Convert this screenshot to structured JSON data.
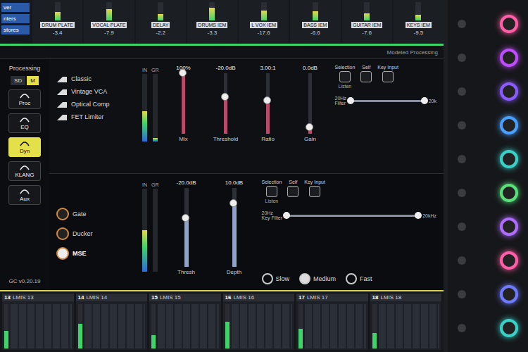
{
  "left_tabs": [
    "ver",
    "nters",
    "stores"
  ],
  "top_strips": [
    {
      "name": "DRUM PLATE",
      "reading": "-3.4",
      "level": 0.45
    },
    {
      "name": "VOCAL PLATE",
      "reading": "-7.9",
      "level": 0.6
    },
    {
      "name": "DELAY",
      "reading": "-2.2",
      "level": 0.35
    },
    {
      "name": "DRUMS IEM",
      "reading": "-3.3",
      "level": 0.7
    },
    {
      "name": "L VOX IEM",
      "reading": "-17.6",
      "level": 0.55
    },
    {
      "name": "BASS IEM",
      "reading": "-6.6",
      "level": 0.5
    },
    {
      "name": "GUITAR IEM",
      "reading": "-7.6",
      "level": 0.4
    },
    {
      "name": "KEYS IEM",
      "reading": "-9.5",
      "level": 0.3
    }
  ],
  "section_title": "Modeled Processing",
  "sidebar": {
    "heading": "Processing",
    "modes": [
      {
        "label": "SD",
        "selected": false
      },
      {
        "label": "M",
        "selected": true
      }
    ],
    "items": [
      {
        "label": "Proc",
        "selected": false
      },
      {
        "label": "EQ",
        "selected": false
      },
      {
        "label": "Dyn",
        "selected": true
      },
      {
        "label": "KLANG",
        "selected": false
      },
      {
        "label": "Aux",
        "selected": false
      }
    ],
    "version": "GC v0.20.19"
  },
  "compressor": {
    "models": [
      {
        "label": "Classic",
        "selected": false
      },
      {
        "label": "Vintage VCA",
        "selected": false
      },
      {
        "label": "Optical Comp",
        "selected": false
      },
      {
        "label": "FET Limiter",
        "selected": false
      }
    ],
    "meters": [
      {
        "label": "IN",
        "level": 0.45
      },
      {
        "label": "GR",
        "level": 0.05
      }
    ],
    "faders": [
      {
        "label": "Mix",
        "value": "100%",
        "level": 1.0
      },
      {
        "label": "Threshold",
        "value": "-20.0dB",
        "level": 0.6
      },
      {
        "label": "Ratio",
        "value": "3.00:1",
        "level": 0.55
      },
      {
        "label": "Gain",
        "value": "0.0dB",
        "level": 0.1
      }
    ],
    "sidechain": [
      {
        "label": "Selection",
        "caption": "Listen",
        "selected": false
      },
      {
        "label": "Self",
        "selected": false
      },
      {
        "label": "Key Input",
        "selected": false
      }
    ],
    "filter": {
      "label": "Filter",
      "low": "20Hz",
      "high": "20k",
      "low_level": 0.0,
      "high_level": 1.0
    }
  },
  "gate": {
    "types": [
      {
        "label": "Gate",
        "selected": false
      },
      {
        "label": "Ducker",
        "selected": false
      },
      {
        "label": "MSE",
        "selected": true
      }
    ],
    "meters": [
      {
        "label": "IN",
        "level": 0.5
      },
      {
        "label": "GR",
        "level": 0.0
      }
    ],
    "faders": [
      {
        "label": "Thresh",
        "value": "-20.0dB",
        "level": 0.62
      },
      {
        "label": "Depth",
        "value": "10.0dB",
        "level": 0.8
      }
    ],
    "sidechain": [
      {
        "label": "Selection",
        "caption": "Listen",
        "selected": false
      },
      {
        "label": "Self",
        "selected": false
      },
      {
        "label": "Key Input",
        "selected": false
      }
    ],
    "key_filter": {
      "label": "Key Filter",
      "low": "20Hz",
      "high": "20kHz",
      "low_level": 0.0,
      "high_level": 1.0
    },
    "speeds": [
      {
        "label": "Slow",
        "selected": false
      },
      {
        "label": "Medium",
        "selected": true
      },
      {
        "label": "Fast",
        "selected": false
      }
    ]
  },
  "bottom_strips": [
    {
      "number": "13",
      "name": "LMIS 13",
      "level": 0.4
    },
    {
      "number": "14",
      "name": "LMIS 14",
      "level": 0.55
    },
    {
      "number": "15",
      "name": "LMIS 15",
      "level": 0.3
    },
    {
      "number": "16",
      "name": "LMIS 16",
      "level": 0.6
    },
    {
      "number": "17",
      "name": "LMIS 17",
      "level": 0.45
    },
    {
      "number": "18",
      "name": "LMIS 18",
      "level": 0.35
    }
  ],
  "knobs": [
    {
      "color": "#ff5fa8"
    },
    {
      "color": "#c04cff"
    },
    {
      "color": "#8a5cff"
    },
    {
      "color": "#4aa0ff"
    },
    {
      "color": "#3ad1c8"
    },
    {
      "color": "#59e07a"
    },
    {
      "color": "#b06cff"
    },
    {
      "color": "#ff5fa8"
    },
    {
      "color": "#6f7bff"
    },
    {
      "color": "#3ad1c8"
    }
  ]
}
